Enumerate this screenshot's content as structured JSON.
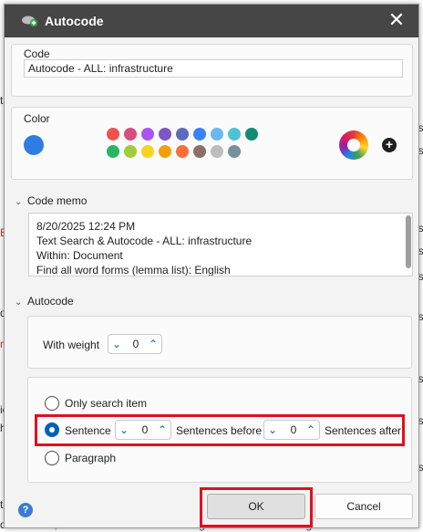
{
  "background": {
    "left_fragments": [
      "t",
      "E",
      "di",
      "ru",
      "ie",
      "h",
      "t"
    ],
    "right_fragments": [
      "s",
      "es",
      "es",
      "es",
      "es",
      "es",
      "es",
      "es",
      "es",
      "es",
      "e"
    ],
    "bottom_text": "data center, but we needed more of a long term solution so things even"
  },
  "dialog": {
    "title": "Autocode",
    "close_label": "✕"
  },
  "code": {
    "label": "Code",
    "value": "Autocode - ALL: infrastructure"
  },
  "color": {
    "label": "Color",
    "current": "#2f7de1",
    "palette": [
      "#ef5350",
      "#d74f7f",
      "#a855f7",
      "#7e57c2",
      "#5c6bc0",
      "#3b82f6",
      "#6cb7f0",
      "#4fc3d2",
      "#138a73",
      "#28b463",
      "#a3cc3a",
      "#fbd31f",
      "#f59e0b",
      "#ff6d3b",
      "#8d6e63",
      "#bdbdbd",
      "#78909c"
    ],
    "add_label": "+"
  },
  "memo": {
    "label": "Code memo",
    "lines": [
      "8/20/2025 12:24 PM",
      "Text Search & Autocode - ALL: infrastructure",
      "Within: Document",
      "Find all word forms (lemma list): English"
    ]
  },
  "autocode": {
    "label": "Autocode",
    "weight_label": "With weight",
    "weight_value": "0",
    "options": {
      "only_search": "Only search item",
      "sentence": "Sentence",
      "paragraph": "Paragraph"
    },
    "selected": "sentence",
    "sentences_before_value": "0",
    "sentences_before_label": "Sentences before",
    "sentences_after_value": "0",
    "sentences_after_label": "Sentences after"
  },
  "buttons": {
    "ok": "OK",
    "cancel": "Cancel",
    "help": "?"
  },
  "icons": {
    "chevron": "chevron-down-icon",
    "spin_down": "chevron-down-icon",
    "spin_up": "chevron-up-icon"
  }
}
